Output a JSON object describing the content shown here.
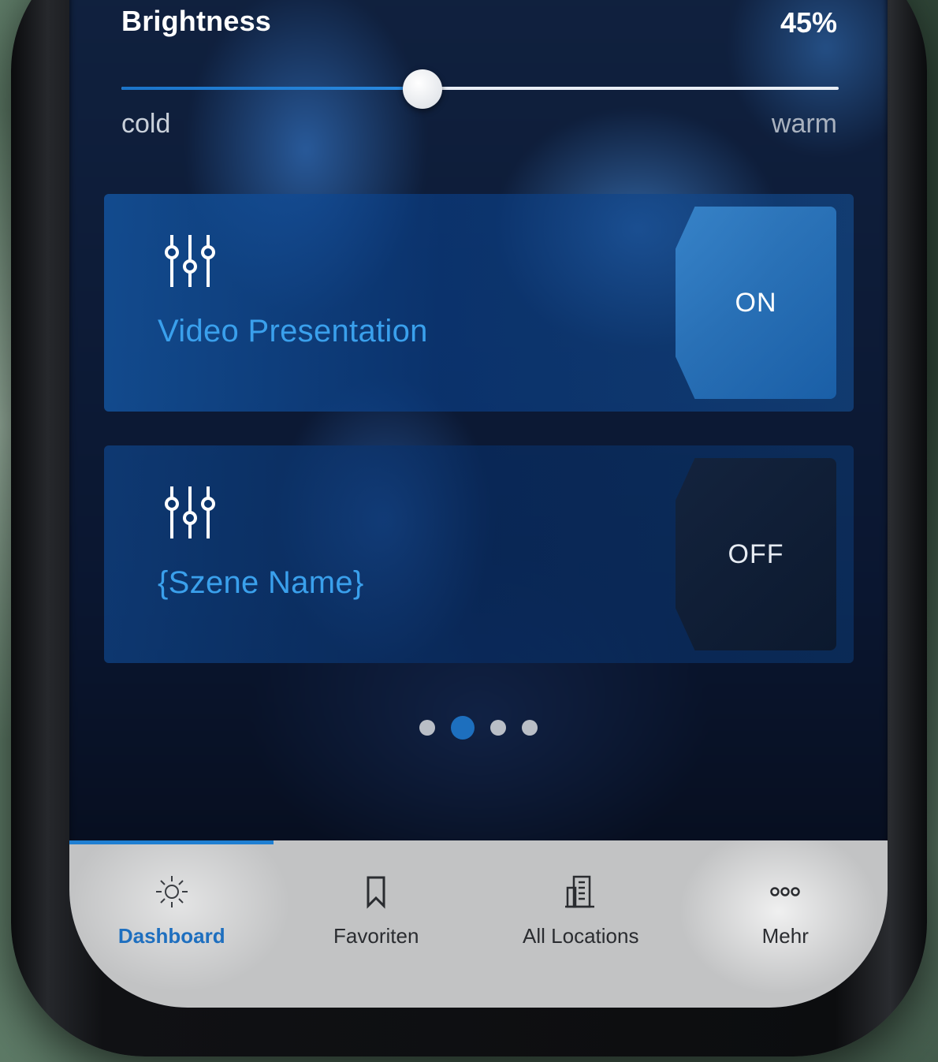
{
  "brightness": {
    "label": "Brightness",
    "value_text": "45%",
    "value": 0.42,
    "min_label": "cold",
    "max_label": "warm"
  },
  "scenes": [
    {
      "name": "Video Presentation",
      "icon": "equalizer-icon",
      "toggle": "ON"
    },
    {
      "name": "{Szene Name}",
      "icon": "equalizer-icon",
      "toggle": "OFF"
    }
  ],
  "pager": {
    "count": 4,
    "active_index": 1
  },
  "tabbar": {
    "active": "Dashboard",
    "tabs": [
      {
        "label": "Dashboard",
        "icon": "sun-icon"
      },
      {
        "label": "Favoriten",
        "icon": "bookmark-icon"
      },
      {
        "label": "All Locations",
        "icon": "building-icon"
      },
      {
        "label": "Mehr",
        "icon": "more-icon"
      }
    ]
  },
  "colors": {
    "accent": "#1f7fd2",
    "scene_name": "#3aa0ec",
    "tabbar_bg": "#c2c3c4"
  }
}
